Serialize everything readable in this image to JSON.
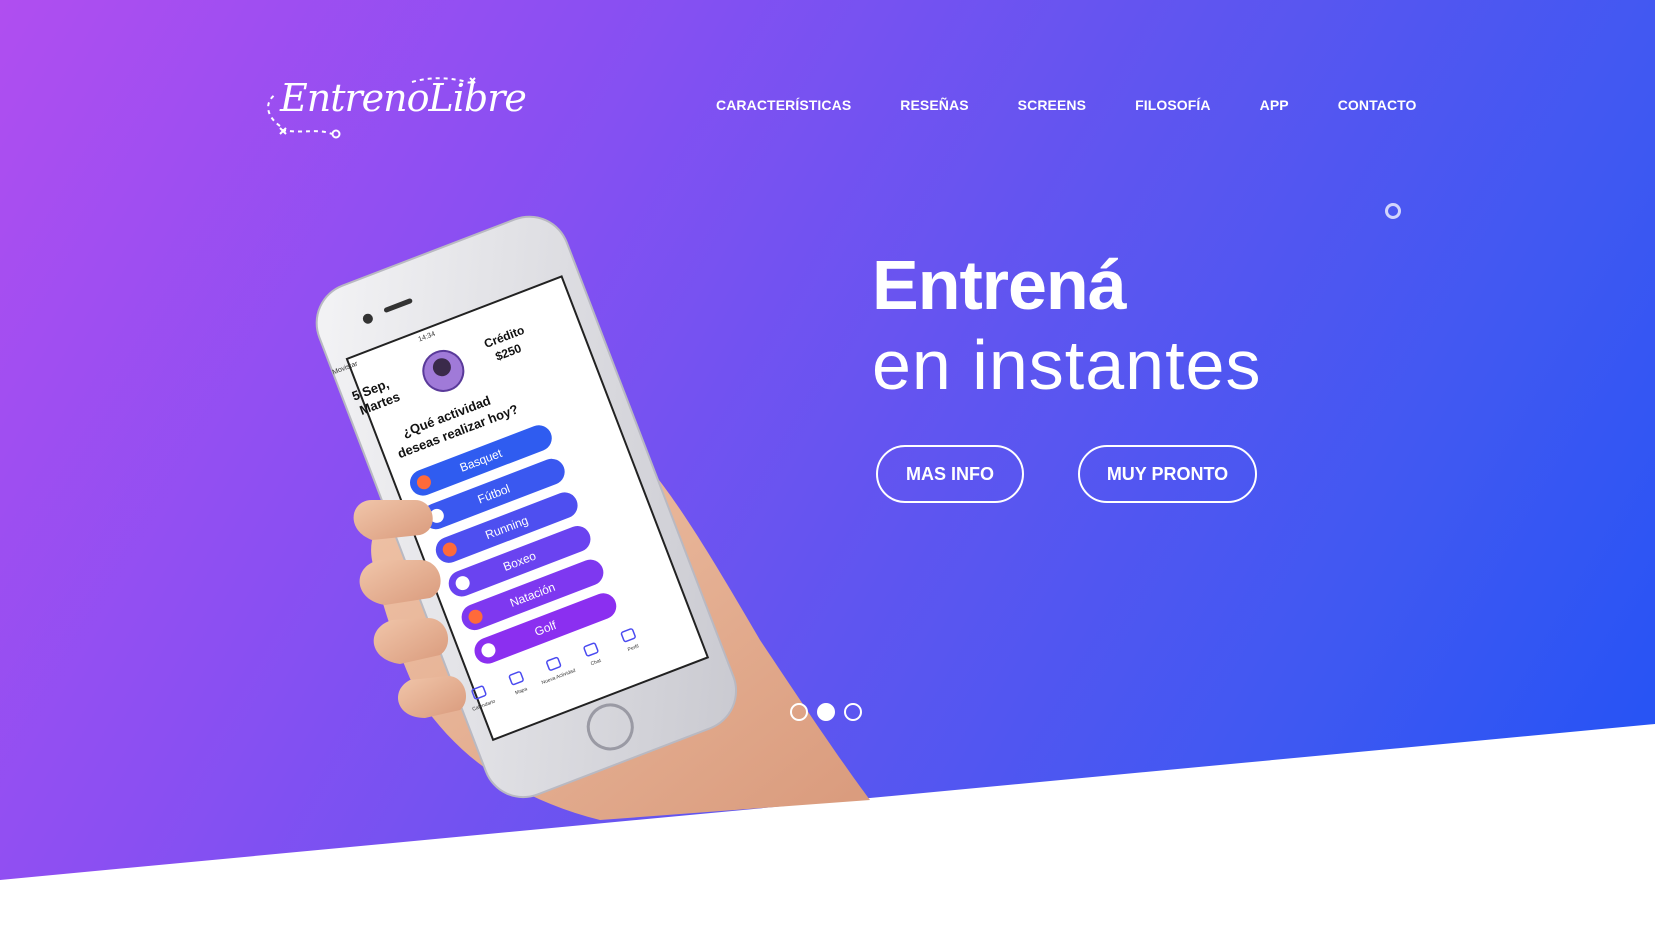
{
  "brand": {
    "name": "EntrenoLibre"
  },
  "nav": {
    "items": [
      {
        "label": "CARACTERÍSTICAS"
      },
      {
        "label": "RESEÑAS"
      },
      {
        "label": "SCREENS"
      },
      {
        "label": "FILOSOFÍA"
      },
      {
        "label": "APP"
      },
      {
        "label": "CONTACTO"
      }
    ]
  },
  "hero": {
    "title_bold": "Entrená",
    "title_light": "en instantes",
    "btn_info": "MAS INFO",
    "btn_soon": "MUY PRONTO",
    "slides": {
      "count": 3,
      "active_index": 1
    }
  },
  "phone": {
    "date_line1": "5 Sep,",
    "date_line2": "Martes",
    "credit_line1": "Crédito",
    "credit_line2": "$250",
    "question_line1": "¿Qué actividad",
    "question_line2": "deseas realizar hoy?",
    "activities": [
      "Basquet",
      "Fútbol",
      "Running",
      "Boxeo",
      "Natación",
      "Golf"
    ],
    "tabbar": [
      "Calendario",
      "Mapa",
      "Nueva Actividad",
      "Chat",
      "Perfil"
    ],
    "carrier": "Movistar",
    "time": "14:34"
  },
  "colors": {
    "gradient_start": "#b04ef0",
    "gradient_end": "#1f52f5",
    "pill_blue": "#2f5cf0",
    "pill_purple": "#8b2ff0"
  }
}
